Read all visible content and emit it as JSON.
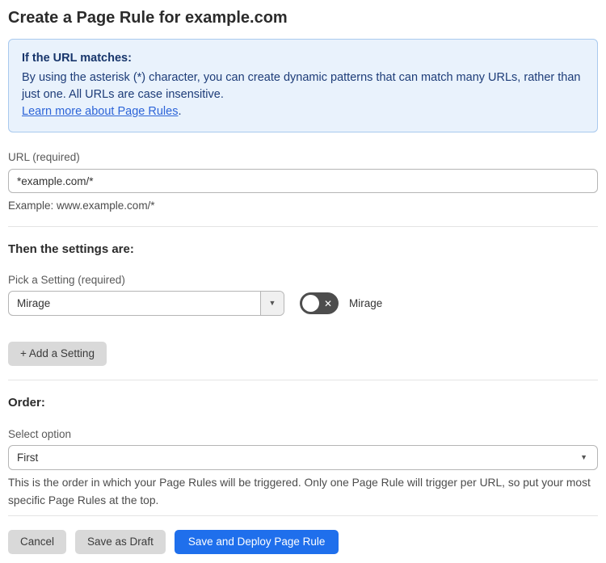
{
  "page": {
    "title": "Create a Page Rule for example.com"
  },
  "info_box": {
    "heading": "If the URL matches:",
    "body": "By using the asterisk (*) character, you can create dynamic patterns that can match many URLs, rather than just one. All URLs are case insensitive.",
    "link": "Learn more about Page Rules",
    "link_suffix": "."
  },
  "url_field": {
    "label": "URL (required)",
    "value": "*example.com/*",
    "helper": "Example: www.example.com/*"
  },
  "settings": {
    "heading": "Then the settings are:",
    "picker_label": "Pick a Setting (required)",
    "selected_setting": "Mirage",
    "toggle_state": "off",
    "toggle_label": "Mirage",
    "add_button_label": "+ Add a Setting"
  },
  "order": {
    "heading": "Order:",
    "label": "Select option",
    "selected_option": "First",
    "helper": "This is the order in which your Page Rules will be triggered. Only one Page Rule will trigger per URL, so put your most specific Page Rules at the top."
  },
  "actions": {
    "cancel_label": "Cancel",
    "save_draft_label": "Save as Draft",
    "save_deploy_label": "Save and Deploy Page Rule"
  },
  "icons": {
    "dropdown_arrow": "▼",
    "toggle_x": "✕"
  },
  "colors": {
    "info_bg": "#e9f2fc",
    "info_border": "#a9c9ee",
    "info_text": "#1d3c78",
    "link": "#2c64d8",
    "primary_button": "#1f6fec",
    "gray_button": "#d9d9d9",
    "toggle_off": "#4d4d4d"
  }
}
